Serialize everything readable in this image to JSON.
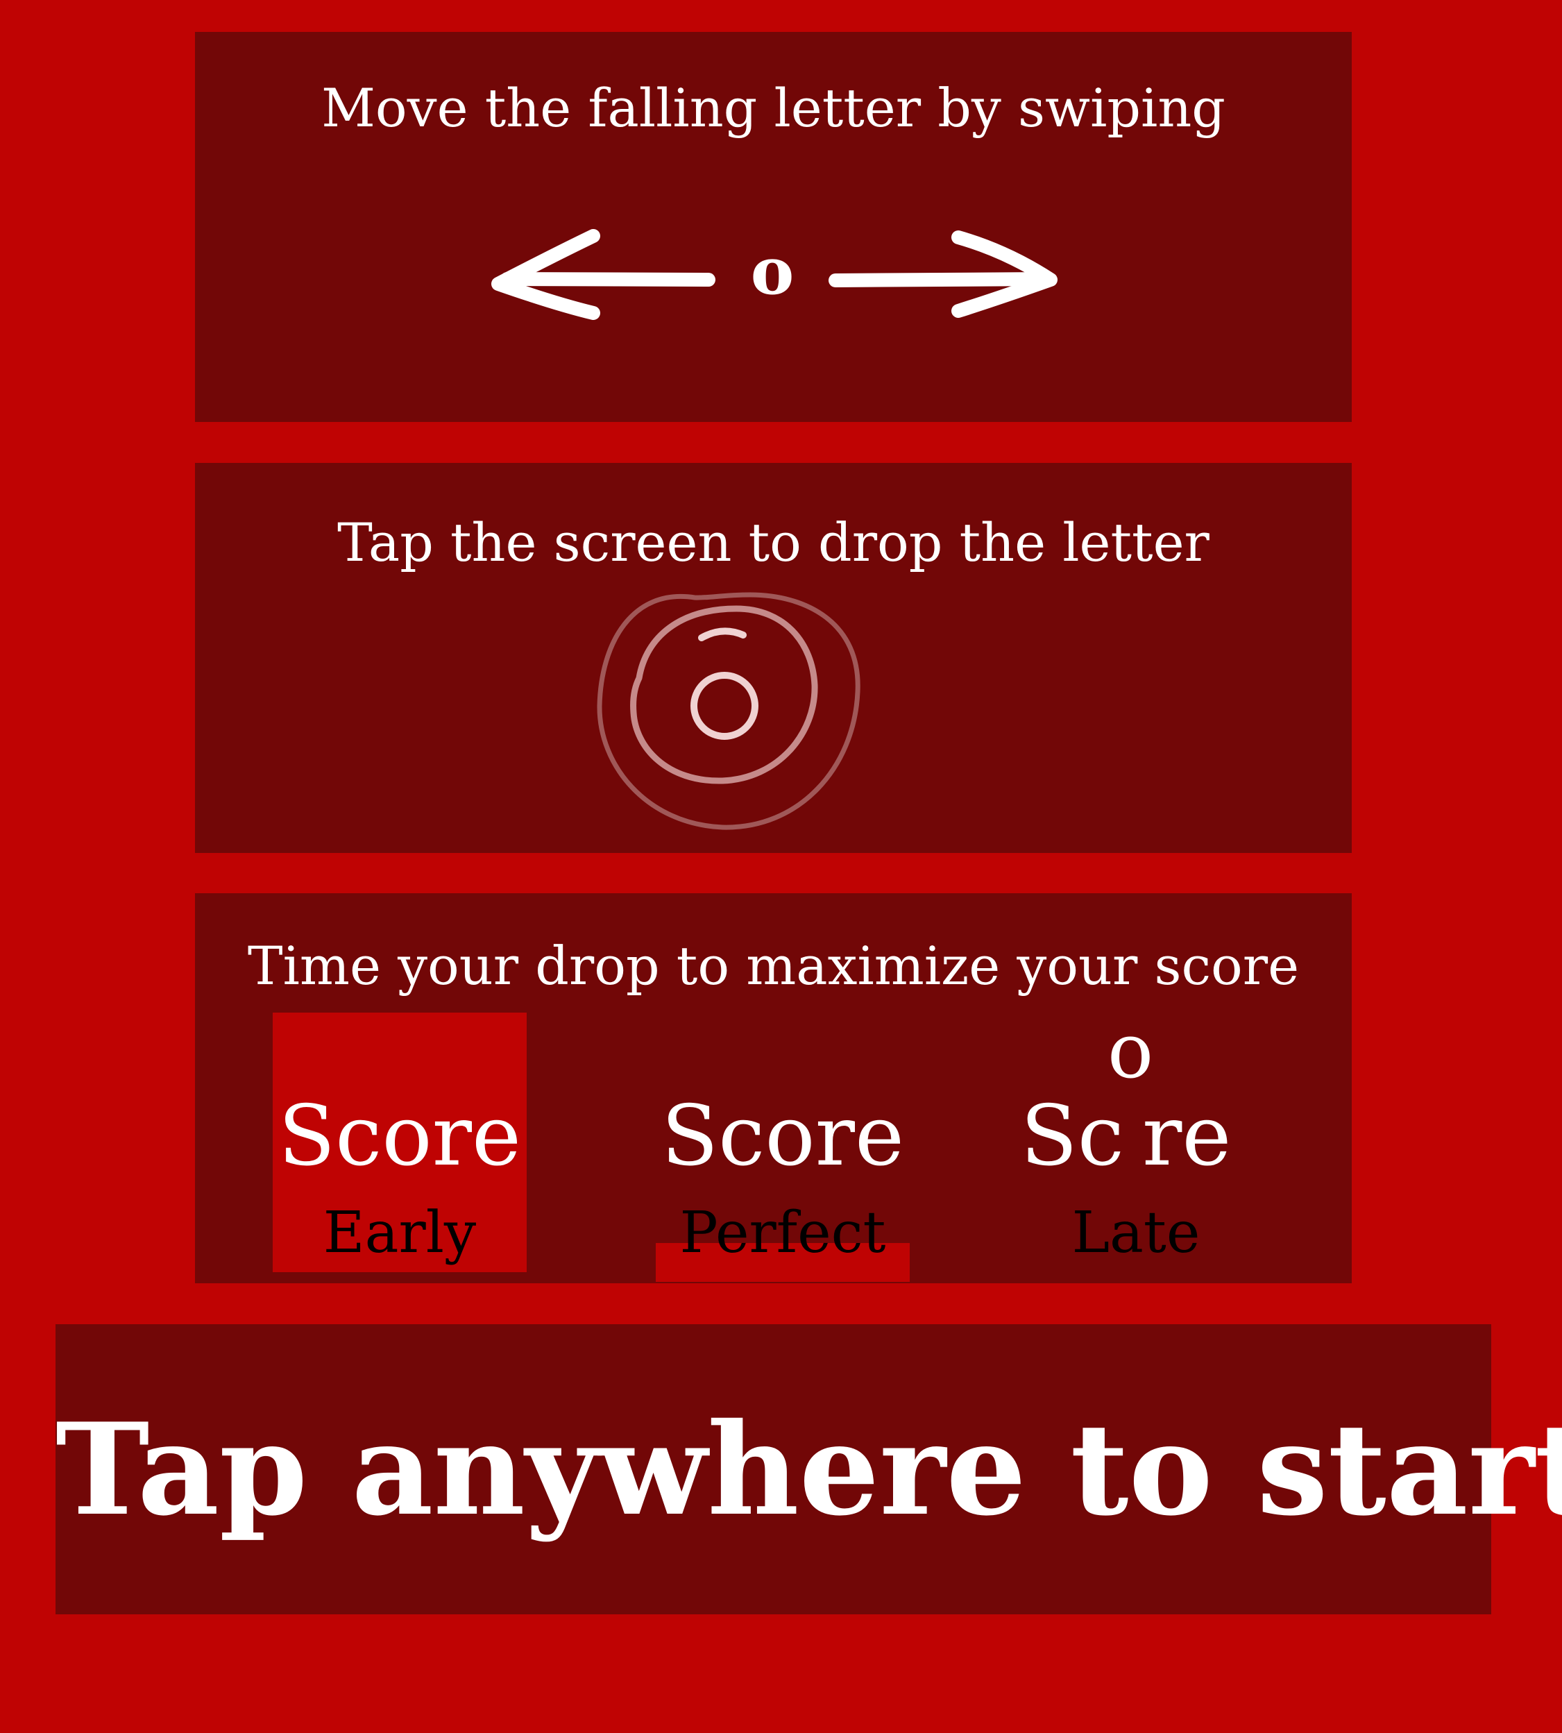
{
  "panels": {
    "swipe": {
      "title": "Move the falling letter by swiping",
      "letter": "o"
    },
    "tap": {
      "title": "Tap the screen to drop the letter"
    },
    "timing": {
      "title": "Time your drop to maximize your score",
      "word": "Score",
      "word_split_left": "Sc",
      "word_split_right": "re",
      "dropped_letter": "o",
      "examples": [
        {
          "label": "Early"
        },
        {
          "label": "Perfect"
        },
        {
          "label": "Late"
        }
      ]
    }
  },
  "start": {
    "label": "Tap anywhere to start"
  },
  "colors": {
    "background": "#bf0303",
    "panel": "#720707",
    "text": "#ffffff",
    "caption": "#000000",
    "ripple": "#a05858"
  }
}
